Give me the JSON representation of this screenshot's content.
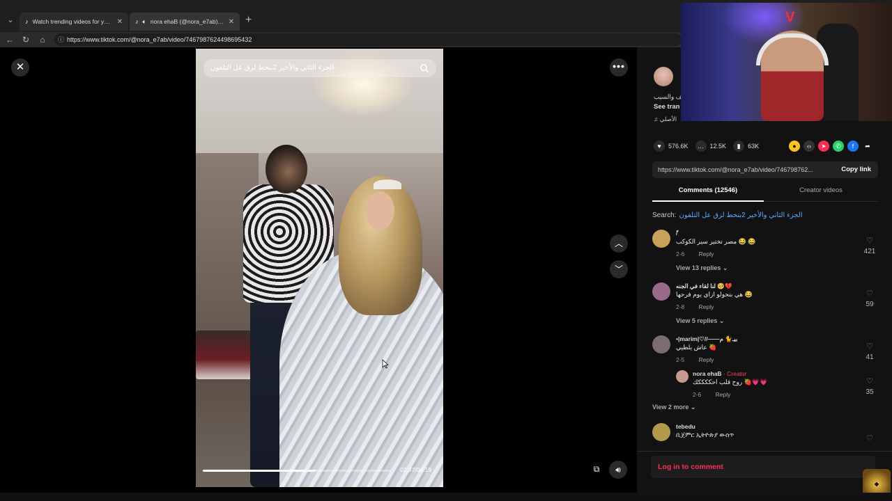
{
  "browser": {
    "tabs": [
      {
        "title": "Watch trending videos for you | Ti",
        "icon": "tiktok-icon"
      },
      {
        "title": "nora ehaB (@nora_e7ab) | Tik",
        "icon": "tiktok-icon"
      }
    ],
    "url": "https://www.tiktok.com/@nora_e7ab/video/7467987624498695432"
  },
  "video": {
    "search_text": "الجزء الثاني والأخير 2بتحط لزق عل التلفون",
    "current_time": "02:37/04:19",
    "progress_fraction": 0.6
  },
  "panel": {
    "description_fragment": "هف والسيب",
    "see_translation": "See tran",
    "music_fragment": "الأصلي",
    "likes": "576.6K",
    "comments_count": "12.5K",
    "saves": "63K",
    "share_link": "https://www.tiktok.com/@nora_e7ab/video/746798762...",
    "copy_link": "Copy link",
    "tab_comments": "Comments (12546)",
    "tab_creator": "Creator videos",
    "search_label": "Search:",
    "search_term": "الجزء الثاني والأخير 2بتحط لزق عل التلفون",
    "login": "Log in to comment"
  },
  "comments": [
    {
      "user": "ً/",
      "text": "مصر تختير سير الكوكب 😂 😂",
      "date": "2-6",
      "reply": "Reply",
      "likes": "421",
      "view_replies": "View 13 replies",
      "avatar_color": "#c9a15a"
    },
    {
      "user": "لنا لقاء في الجنه 🥺💔",
      "text": "هي بتحولو ازاي يوم فرحها 😂",
      "date": "2-8",
      "reply": "Reply",
      "likes": "59",
      "view_replies": "View 5 replies",
      "avatar_color": "#9a6a8a"
    },
    {
      "user": "•|marim|♡//——بيـ🐈 م",
      "text": "عاش يلطيي 🍓",
      "date": "2-5",
      "reply": "Reply",
      "likes": "41",
      "view_replies": "View 2 more",
      "avatar_color": "#7d6b73"
    },
    {
      "user": "nora ehaB",
      "creator": "· Creator",
      "text": "روح قلب احككككك 🍓💗💗",
      "date": "2-6",
      "reply": "Reply",
      "likes": "35",
      "avatar_color": "#c69a8c"
    },
    {
      "user": "tebedu",
      "text": "ቢጀምር ኢትዮጵያ ውስጥ",
      "avatar_color": "#b39a4a"
    }
  ],
  "colors": {
    "accent": "#fe2c55",
    "link": "#5aa9ff",
    "background": "#000000",
    "panel": "#121212"
  }
}
